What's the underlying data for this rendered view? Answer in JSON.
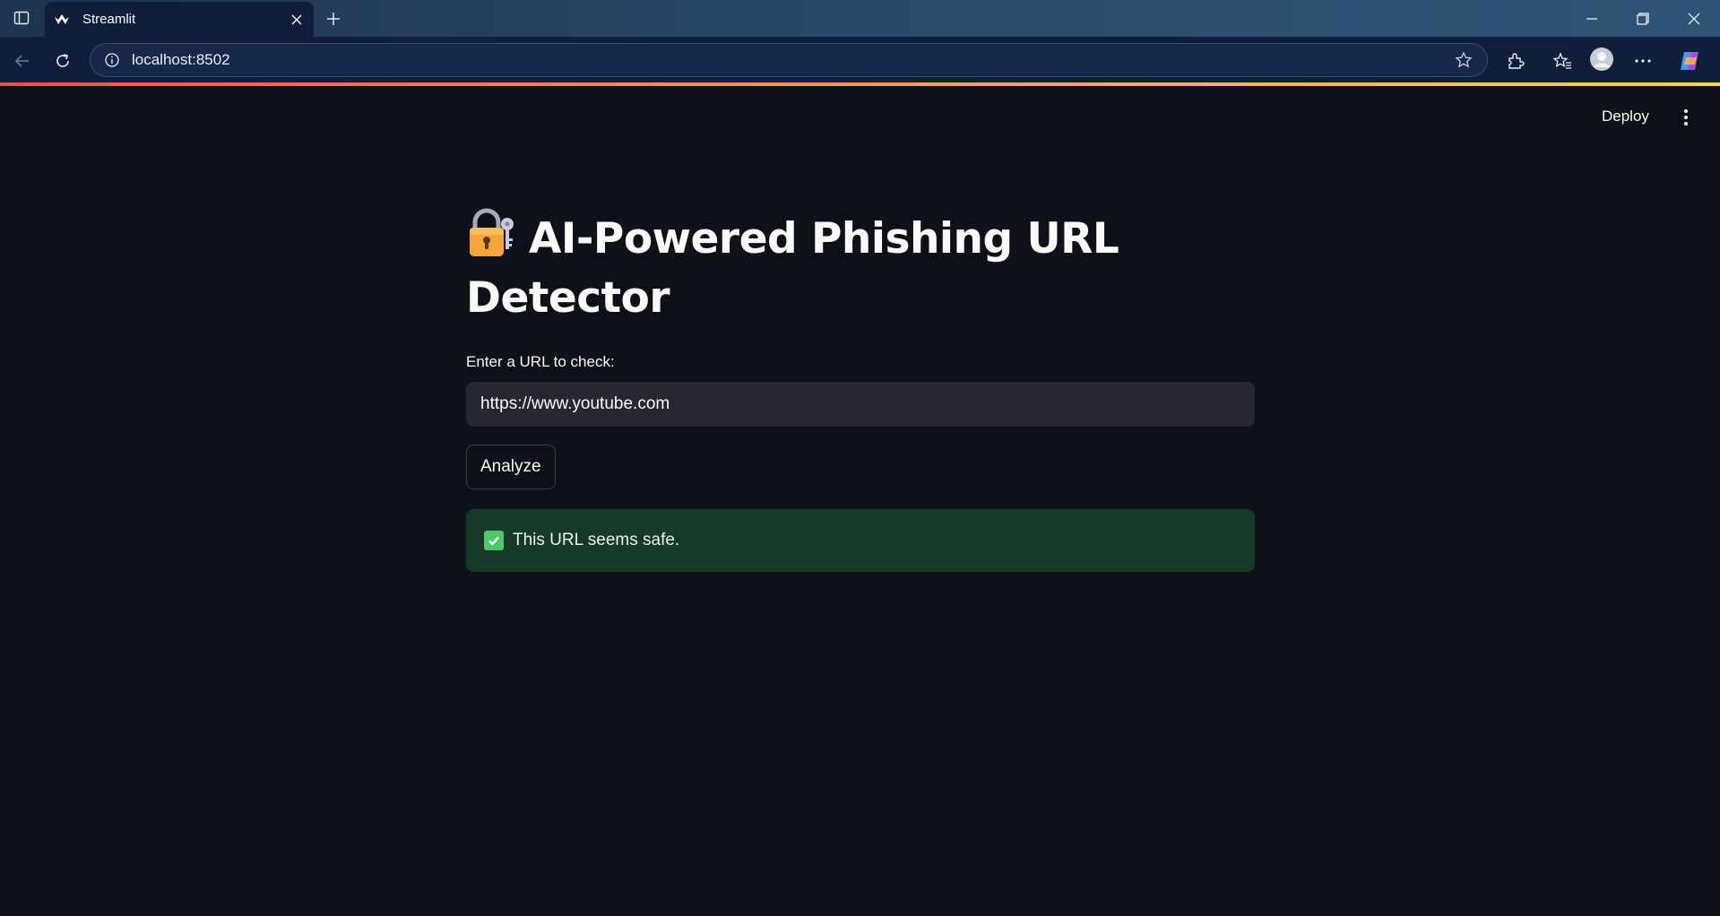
{
  "browser": {
    "tab_title": "Streamlit",
    "url": "localhost:8502"
  },
  "header": {
    "deploy_label": "Deploy"
  },
  "main": {
    "title": "AI-Powered Phishing URL Detector",
    "title_icon": "locked-with-key-icon",
    "input_label": "Enter a URL to check:",
    "input_value": "https://www.youtube.com",
    "button_label": "Analyze",
    "result_message": "This URL seems safe.",
    "result_status": "success"
  },
  "colors": {
    "background": "#0e1117",
    "input_bg": "#262730",
    "success_bg": "#173928",
    "success_accent": "#4fc76b",
    "accent_gradient": [
      "#ff4b4b",
      "#ffd34a"
    ]
  }
}
